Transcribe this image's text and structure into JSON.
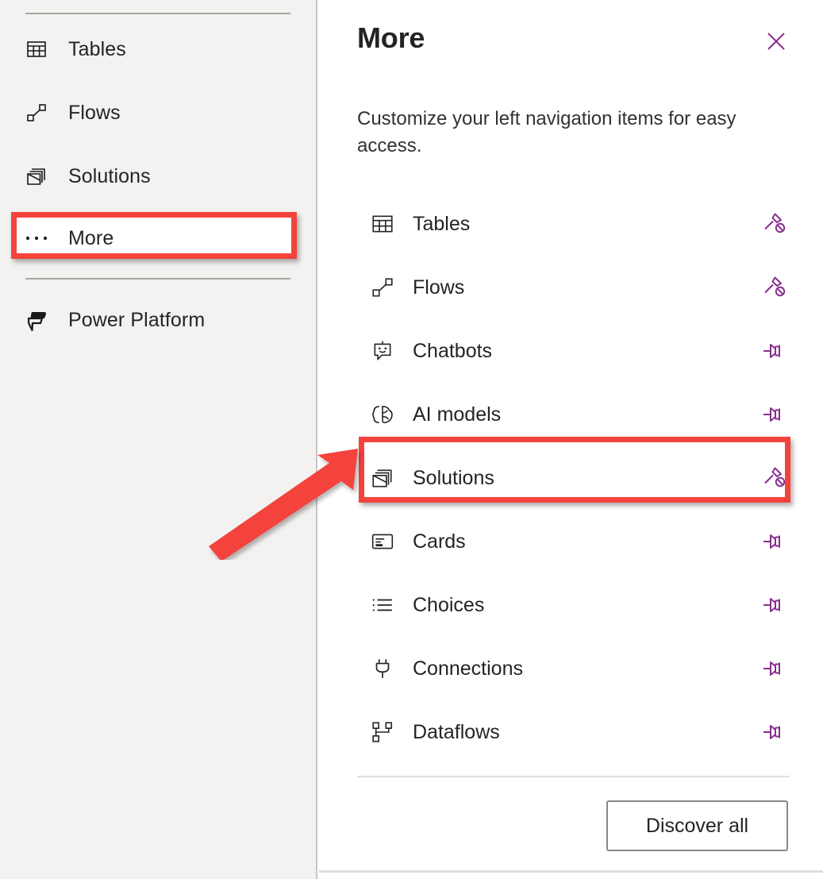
{
  "sidebar": {
    "items": [
      {
        "label": "Tables",
        "icon": "table-icon"
      },
      {
        "label": "Flows",
        "icon": "flow-icon"
      },
      {
        "label": "Solutions",
        "icon": "solutions-icon"
      },
      {
        "label": "More",
        "icon": "ellipsis-icon"
      },
      {
        "label": "Power Platform",
        "icon": "power-platform-icon"
      }
    ]
  },
  "panel": {
    "title": "More",
    "close_label": "Close",
    "subtitle": "Customize your left navigation items for easy access.",
    "items": [
      {
        "label": "Tables",
        "icon": "table-icon",
        "pin_state": "unpin",
        "pin_name": "unpin-icon"
      },
      {
        "label": "Flows",
        "icon": "flow-icon",
        "pin_state": "unpin",
        "pin_name": "unpin-icon"
      },
      {
        "label": "Chatbots",
        "icon": "chatbot-icon",
        "pin_state": "pin",
        "pin_name": "pin-icon"
      },
      {
        "label": "AI models",
        "icon": "ai-brain-icon",
        "pin_state": "pin",
        "pin_name": "pin-icon"
      },
      {
        "label": "Solutions",
        "icon": "solutions-icon",
        "pin_state": "unpin",
        "pin_name": "unpin-icon"
      },
      {
        "label": "Cards",
        "icon": "card-icon",
        "pin_state": "pin",
        "pin_name": "pin-icon"
      },
      {
        "label": "Choices",
        "icon": "list-icon",
        "pin_state": "pin",
        "pin_name": "pin-icon"
      },
      {
        "label": "Connections",
        "icon": "plug-icon",
        "pin_state": "pin",
        "pin_name": "pin-icon"
      },
      {
        "label": "Dataflows",
        "icon": "dataflow-icon",
        "pin_state": "pin",
        "pin_name": "pin-icon"
      }
    ],
    "discover_all_label": "Discover all"
  },
  "annotations": {
    "highlight_color": "#F4433C",
    "accent_color": "#8A2F8F",
    "highlighted_items": [
      "More",
      "Solutions"
    ]
  }
}
